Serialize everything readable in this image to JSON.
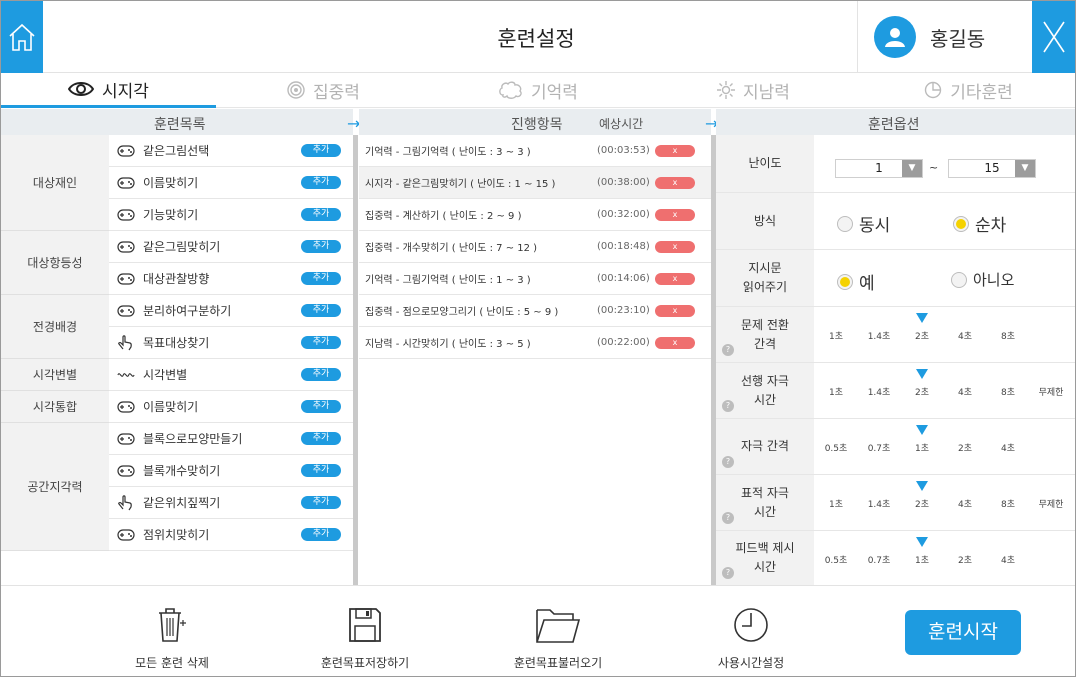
{
  "header": {
    "title": "훈련설정",
    "user_name": "홍길동"
  },
  "tabs": [
    {
      "label": "시지각",
      "active": true,
      "icon": "eye-icon"
    },
    {
      "label": "집중력",
      "active": false,
      "icon": "target-icon"
    },
    {
      "label": "기억력",
      "active": false,
      "icon": "brain-icon"
    },
    {
      "label": "지남력",
      "active": false,
      "icon": "sun-icon"
    },
    {
      "label": "기타훈련",
      "active": false,
      "icon": "pie-icon"
    }
  ],
  "columns": {
    "list": "훈련목록",
    "progress": "진행항목",
    "eta": "예상시간",
    "options": "훈련옵션"
  },
  "groups": [
    {
      "label": "대상재인"
    },
    {
      "label": "대상항등성"
    },
    {
      "label": "전경배경"
    },
    {
      "label": "시각변별"
    },
    {
      "label": "시각통합"
    },
    {
      "label": "공간지각력"
    }
  ],
  "items": [
    {
      "label": "같은그림선택",
      "icon": "gamepad-icon",
      "add": "추가"
    },
    {
      "label": "이름맞히기",
      "icon": "gamepad-icon",
      "add": "추가"
    },
    {
      "label": "기능맞히기",
      "icon": "gamepad-icon",
      "add": "추가"
    },
    {
      "label": "같은그림맞히기",
      "icon": "gamepad-icon",
      "add": "추가"
    },
    {
      "label": "대상관찰방향",
      "icon": "gamepad-icon",
      "add": "추가"
    },
    {
      "label": "분리하여구분하기",
      "icon": "gamepad-icon",
      "add": "추가"
    },
    {
      "label": "목표대상찾기",
      "icon": "touch-icon",
      "add": "추가"
    },
    {
      "label": "시각변별",
      "icon": "gesture-icon",
      "add": "추가"
    },
    {
      "label": "이름맞히기",
      "icon": "gamepad-icon",
      "add": "추가"
    },
    {
      "label": "블록으로모양만들기",
      "icon": "gamepad-icon",
      "add": "추가"
    },
    {
      "label": "블록개수맞히기",
      "icon": "gamepad-icon",
      "add": "추가"
    },
    {
      "label": "같은위치짚찍기",
      "icon": "touch-icon",
      "add": "추가"
    },
    {
      "label": "점위치맞히기",
      "icon": "gamepad-icon",
      "add": "추가"
    }
  ],
  "progress": [
    {
      "text": "기억력 - 그림기억력 ( 난이도 : 3 ~ 3 )",
      "time": "(00:03:53)",
      "del": "x"
    },
    {
      "text": "시지각 - 같은그림맞히기 ( 난이도 : 1 ~ 15 )",
      "time": "(00:38:00)",
      "del": "x"
    },
    {
      "text": "집중력 - 계산하기 ( 난이도 : 2 ~ 9 )",
      "time": "(00:32:00)",
      "del": "x"
    },
    {
      "text": "집중력 - 개수맞히기 ( 난이도 : 7 ~ 12 )",
      "time": "(00:18:48)",
      "del": "x"
    },
    {
      "text": "기억력 - 그림기억력 ( 난이도 : 1 ~ 3 )",
      "time": "(00:14:06)",
      "del": "x"
    },
    {
      "text": "집중력 - 점으로모양그리기 ( 난이도 : 5 ~ 9 )",
      "time": "(00:23:10)",
      "del": "x"
    },
    {
      "text": "지남력 - 시간맞히기 ( 난이도 : 3 ~ 5 )",
      "time": "(00:22:00)",
      "del": "x"
    }
  ],
  "options": {
    "difficulty": {
      "label": "난이도",
      "from": "1",
      "to": "15",
      "sep": "~"
    },
    "method": {
      "label": "방식",
      "opt1": "동시",
      "opt2": "순차",
      "selected": "순차"
    },
    "read": {
      "label1": "지시문",
      "label2": "읽어주기",
      "opt1": "예",
      "opt2": "아니오",
      "selected": "예"
    },
    "help": "?",
    "sliders": [
      {
        "label1": "문제 전환",
        "label2": "간격",
        "ticks": [
          "1초",
          "1.4초",
          "2초",
          "4초",
          "8초"
        ],
        "selected_index": 2
      },
      {
        "label1": "선행 자극",
        "label2": "시간",
        "ticks": [
          "1초",
          "1.4초",
          "2초",
          "4초",
          "8초",
          "무제한"
        ],
        "selected_index": 2
      },
      {
        "label1": "자극 간격",
        "label2": "",
        "ticks": [
          "0.5초",
          "0.7초",
          "1초",
          "2초",
          "4초"
        ],
        "selected_index": 2
      },
      {
        "label1": "표적 자극",
        "label2": "시간",
        "ticks": [
          "1초",
          "1.4초",
          "2초",
          "4초",
          "8초",
          "무제한"
        ],
        "selected_index": 2
      },
      {
        "label1": "피드백 제시",
        "label2": "시간",
        "ticks": [
          "0.5초",
          "0.7초",
          "1초",
          "2초",
          "4초"
        ],
        "selected_index": 2
      }
    ]
  },
  "footer": {
    "delete_all": "모든 훈련 삭제",
    "save": "훈련목표저장하기",
    "load": "훈련목표불러오기",
    "time_setting": "사용시간설정",
    "start": "훈련시작"
  },
  "colors": {
    "accent": "#1e9be0",
    "delete": "#ef6f6f",
    "radio_on": "#f5d200"
  }
}
